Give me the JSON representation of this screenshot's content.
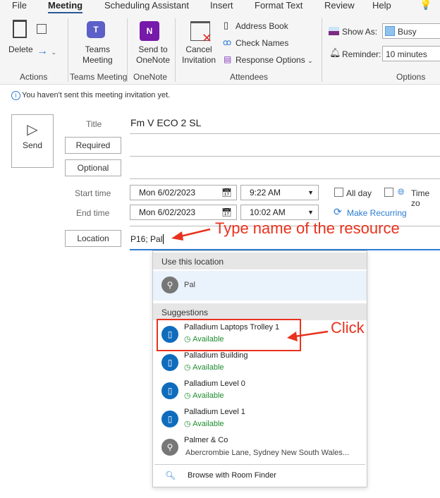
{
  "ribbon": {
    "tabs": [
      "File",
      "Meeting",
      "Scheduling Assistant",
      "Insert",
      "Format Text",
      "Review",
      "Help"
    ],
    "delete": "Delete",
    "teams": "Teams Meeting",
    "teams_l1": "Teams",
    "teams_l2": "Meeting",
    "onenote_l1": "Send to",
    "onenote_l2": "OneNote",
    "cancel_l1": "Cancel",
    "cancel_l2": "Invitation",
    "address_book": "Address Book",
    "check_names": "Check Names",
    "response_options": "Response Options",
    "show_as_label": "Show As:",
    "show_as_value": "Busy",
    "reminder_label": "Reminder:",
    "reminder_value": "10 minutes",
    "groups": [
      "Actions",
      "Teams Meeting",
      "OneNote",
      "Attendees",
      "Options"
    ]
  },
  "info": "You haven't sent this meeting invitation yet.",
  "form": {
    "send": "Send",
    "title_label": "Title",
    "title_value": "Fm V ECO 2 SL",
    "required": "Required",
    "optional": "Optional",
    "start_label": "Start time",
    "start_date": "Mon 6/02/2023",
    "start_time": "9:22 AM",
    "end_label": "End time",
    "end_date": "Mon 6/02/2023",
    "end_time": "10:02 AM",
    "all_day": "All day",
    "time_zones": "Time zo",
    "make_recurring": "Make Recurring",
    "location_label": "Location",
    "location_value": "P16; Pal"
  },
  "dropdown": {
    "use_header": "Use this location",
    "use_value": "Pal",
    "suggest_header": "Suggestions",
    "items": [
      {
        "name": "Palladium Laptops Trolley 1",
        "sub": "Available"
      },
      {
        "name": "Palladium Building",
        "sub": "Available"
      },
      {
        "name": "Palladium Level 0",
        "sub": "Available"
      },
      {
        "name": "Palladium Level 1",
        "sub": "Available"
      },
      {
        "name": "Palmer & Co",
        "sub": "Abercrombie Lane, Sydney  New South Wales..."
      }
    ],
    "browse": "Browse with Room Finder"
  },
  "annotations": {
    "type_hint": "Type name of the resource",
    "click_hint": "Click"
  },
  "colors": {
    "accent": "#2b5797",
    "annotation": "#e8321e",
    "available": "#1e8c2e",
    "room": "#0f6cbd"
  }
}
